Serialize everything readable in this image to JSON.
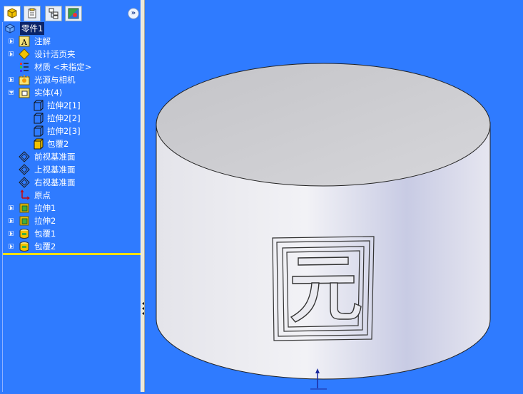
{
  "panel_tabs": [
    {
      "name": "feature-manager",
      "icon": "feature-manager-icon",
      "active": true
    },
    {
      "name": "property-manager",
      "icon": "property-manager-icon",
      "active": false
    },
    {
      "name": "configuration-manager",
      "icon": "configuration-manager-icon",
      "active": false
    },
    {
      "name": "display-manager",
      "icon": "display-manager-icon",
      "active": false
    }
  ],
  "expand_button": "»",
  "tree": {
    "root": {
      "label": "零件1",
      "icon": "part-icon"
    },
    "items": [
      {
        "label": "注解",
        "icon": "annotation-icon",
        "expander": "collapsed"
      },
      {
        "label": "设计活页夹",
        "icon": "design-binder-icon",
        "expander": "collapsed"
      },
      {
        "label": "材质 <未指定>",
        "icon": "material-icon",
        "expander": "none"
      },
      {
        "label": "光源与相机",
        "icon": "lights-camera-icon",
        "expander": "collapsed"
      },
      {
        "label": "实体(4)",
        "icon": "solid-bodies-icon",
        "expander": "expanded"
      },
      {
        "label": "拉伸2[1]",
        "icon": "body-icon",
        "expander": "none",
        "child": true
      },
      {
        "label": "拉伸2[2]",
        "icon": "body-icon",
        "expander": "none",
        "child": true
      },
      {
        "label": "拉伸2[3]",
        "icon": "body-icon",
        "expander": "none",
        "child": true
      },
      {
        "label": "包覆2",
        "icon": "wrap-body-icon",
        "expander": "none",
        "child": true
      },
      {
        "label": "前视基准面",
        "icon": "plane-icon",
        "expander": "none"
      },
      {
        "label": "上视基准面",
        "icon": "plane-icon",
        "expander": "none"
      },
      {
        "label": "右视基准面",
        "icon": "plane-icon",
        "expander": "none"
      },
      {
        "label": "原点",
        "icon": "origin-icon",
        "expander": "none"
      },
      {
        "label": "拉伸1",
        "icon": "extrude-icon",
        "expander": "collapsed"
      },
      {
        "label": "拉伸2",
        "icon": "extrude-icon",
        "expander": "collapsed"
      },
      {
        "label": "包覆1",
        "icon": "wrap-icon",
        "expander": "collapsed"
      },
      {
        "label": "包覆2",
        "icon": "wrap-icon",
        "expander": "collapsed"
      }
    ]
  },
  "model": {
    "emboss_character": "元",
    "body_color": "#e6e6ee",
    "top_color": "#c4c4c8"
  },
  "colors": {
    "background": "#2f7bff",
    "selection": "#0a246a",
    "rollback_bar": "#f3e000"
  }
}
